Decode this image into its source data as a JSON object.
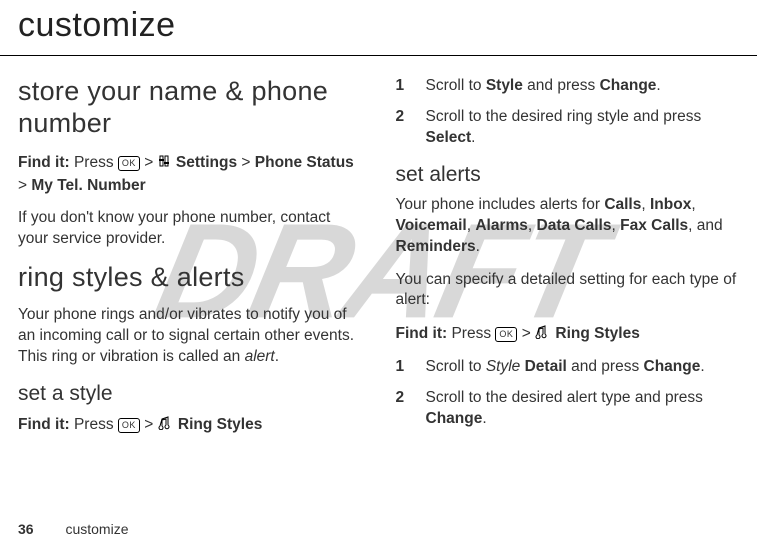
{
  "watermark": "DRAFT",
  "page_title": "customize",
  "left": {
    "h_store": "store your name & phone number",
    "find1_label": "Find it:",
    "find1_press": "Press",
    "find1_ok": "OK",
    "find1_gt1": ">",
    "find1_settings": "Settings",
    "find1_gt2": ">",
    "find1_phonestatus": "Phone Status",
    "find1_gt3": ">",
    "find1_mytel": "My Tel. Number",
    "p_store": "If you don't know your phone number, contact your service provider.",
    "h_ring": "ring styles & alerts",
    "p_ring_a": "Your phone rings and/or vibrates to notify you of an incoming call or to signal certain other events. This ring or vibration is called an ",
    "p_ring_b": "alert",
    "p_ring_c": ".",
    "h_setstyle": "set a style",
    "find2_label": "Find it:",
    "find2_press": "Press",
    "find2_ok": "OK",
    "find2_gt": ">",
    "find2_ringstyles": "Ring Styles"
  },
  "right": {
    "step1_num": "1",
    "step1_a": "Scroll to ",
    "step1_b": "Style",
    "step1_c": " and press ",
    "step1_d": "Change",
    "step1_e": ".",
    "step2_num": "2",
    "step2_a": "Scroll to the desired ring style and press ",
    "step2_b": "Select",
    "step2_c": ".",
    "h_setalerts": "set alerts",
    "p_alerts_a": "Your phone includes alerts for ",
    "p_alerts_b": "Calls",
    "p_alerts_c": ", ",
    "p_alerts_d": "Inbox",
    "p_alerts_e": ", ",
    "p_alerts_f": "Voicemail",
    "p_alerts_g": ", ",
    "p_alerts_h": "Alarms",
    "p_alerts_i": ", ",
    "p_alerts_j": "Data Calls",
    "p_alerts_k": ", ",
    "p_alerts_l": "Fax Calls",
    "p_alerts_m": ", and ",
    "p_alerts_n": "Reminders",
    "p_alerts_o": ".",
    "p_specify": "You can specify a detailed setting for each type of alert:",
    "find3_label": "Find it:",
    "find3_press": "Press",
    "find3_ok": "OK",
    "find3_gt": ">",
    "find3_ringstyles": "Ring Styles",
    "step3_num": "1",
    "step3_a": "Scroll to ",
    "step3_b": "Style",
    "step3_c": " ",
    "step3_d": "Detail",
    "step3_e": " and press ",
    "step3_f": "Change",
    "step3_g": ".",
    "step4_num": "2",
    "step4_a": "Scroll to the desired alert type and press ",
    "step4_b": "Change",
    "step4_c": "."
  },
  "footer": {
    "page_num": "36",
    "section": "customize"
  }
}
